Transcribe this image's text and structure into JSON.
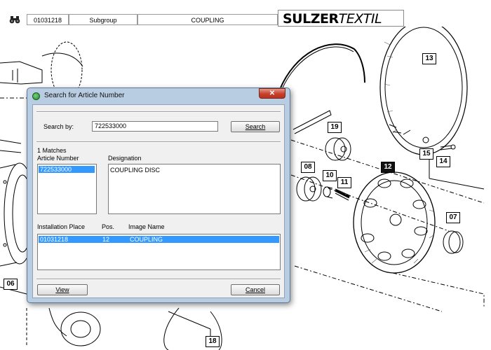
{
  "header": {
    "article_field": "01031218",
    "subgroup_label": "Subgroup",
    "subgroup_value": "COUPLING",
    "brand_bold": "SULZER",
    "brand_light": "TEXTIL"
  },
  "drawing": {
    "callouts": [
      "13",
      "19",
      "15",
      "14",
      "12",
      "08",
      "10",
      "11",
      "07",
      "06",
      "18"
    ]
  },
  "dialog": {
    "title": "Search for Article Number",
    "close_glyph": "✕",
    "search_by_label": "Search by:",
    "search_value": "722533000",
    "search_button": "Search",
    "match_count": "1 Matches",
    "article_number_header": "Article Number",
    "designation_header": "Designation",
    "article_items": [
      "722533000"
    ],
    "designation_text": "COUPLING DISC",
    "installation": {
      "headers": [
        "Installation Place",
        "Pos.",
        "Image Name"
      ],
      "rows": [
        {
          "place": "01031218",
          "pos": "12",
          "image": "COUPLING"
        }
      ]
    },
    "view_button": "View",
    "cancel_button": "Cancel"
  }
}
